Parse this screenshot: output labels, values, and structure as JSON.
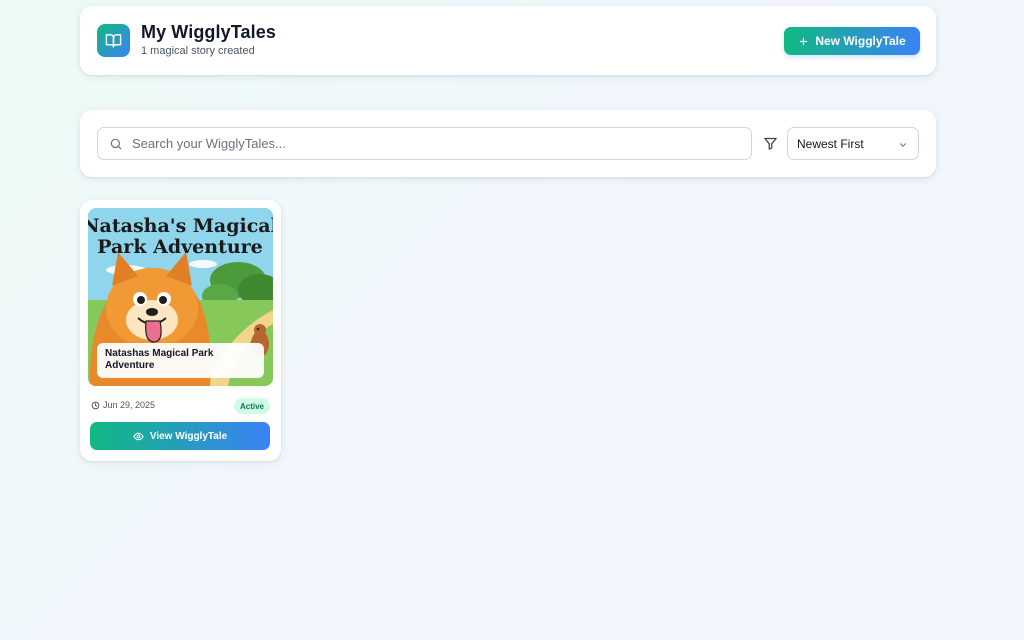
{
  "header": {
    "logo_icon": "book-open-icon",
    "title": "My WigglyTales",
    "subtitle": "1 magical story created",
    "new_button_label": "New WigglyTale",
    "new_button_icon": "plus-icon"
  },
  "toolbar": {
    "search_placeholder": "Search your WigglyTales...",
    "search_value": "",
    "search_icon": "search-icon",
    "filter_icon": "filter-icon",
    "sort_selected": "Newest First"
  },
  "stories": [
    {
      "cover_title": "Natasha's Magical Park Adventure",
      "caption": "Natashas Magical Park Adventure",
      "date": "Jun 29, 2025",
      "status": "Active",
      "view_label": "View WigglyTale"
    }
  ],
  "colors": {
    "accent_green": "#10b981",
    "accent_blue": "#3b82f6",
    "badge_bg": "#d1fae5",
    "badge_text": "#047857"
  }
}
